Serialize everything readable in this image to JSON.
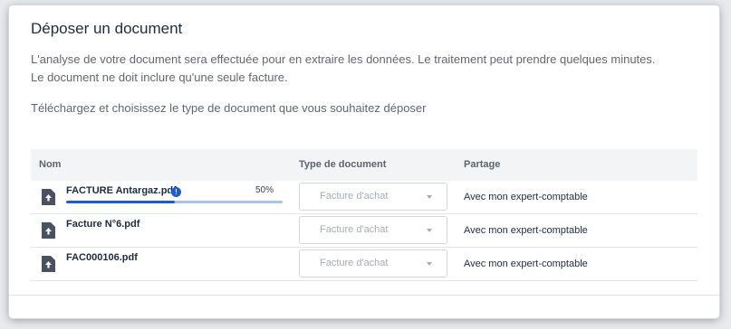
{
  "modal": {
    "title": "Déposer un document",
    "intro_line1": "L'analyse de votre document sera effectuée pour en extraire les données. Le traitement peut prendre quelques minutes.",
    "intro_line2": "Le document ne doit inclure qu'une seule facture.",
    "intro_line3": "Téléchargez et choisissez le type de document que vous souhaitez déposer"
  },
  "table": {
    "headers": {
      "name": "Nom",
      "type": "Type de document",
      "share": "Partage"
    },
    "rows": [
      {
        "name": "FACTURE Antargaz.pdf",
        "has_info_icon": true,
        "progress_label": "50%",
        "progress": 0.5,
        "type_placeholder": "Facture d'achat",
        "share": "Avec mon expert-comptable"
      },
      {
        "name": "Facture N°6.pdf",
        "has_info_icon": false,
        "type_placeholder": "Facture d'achat",
        "share": "Avec mon expert-comptable"
      },
      {
        "name": "FAC000106.pdf",
        "has_info_icon": false,
        "type_placeholder": "Facture d'achat",
        "share": "Avec mon expert-comptable"
      }
    ]
  },
  "icons": {
    "file": "file-upload-icon",
    "info": "info-icon",
    "caret": "chevron-down-icon"
  },
  "colors": {
    "accent": "#1a5cd8",
    "progress_track": "#a9c2ef",
    "title": "#1d2b40",
    "muted_text": "#5f6773"
  }
}
